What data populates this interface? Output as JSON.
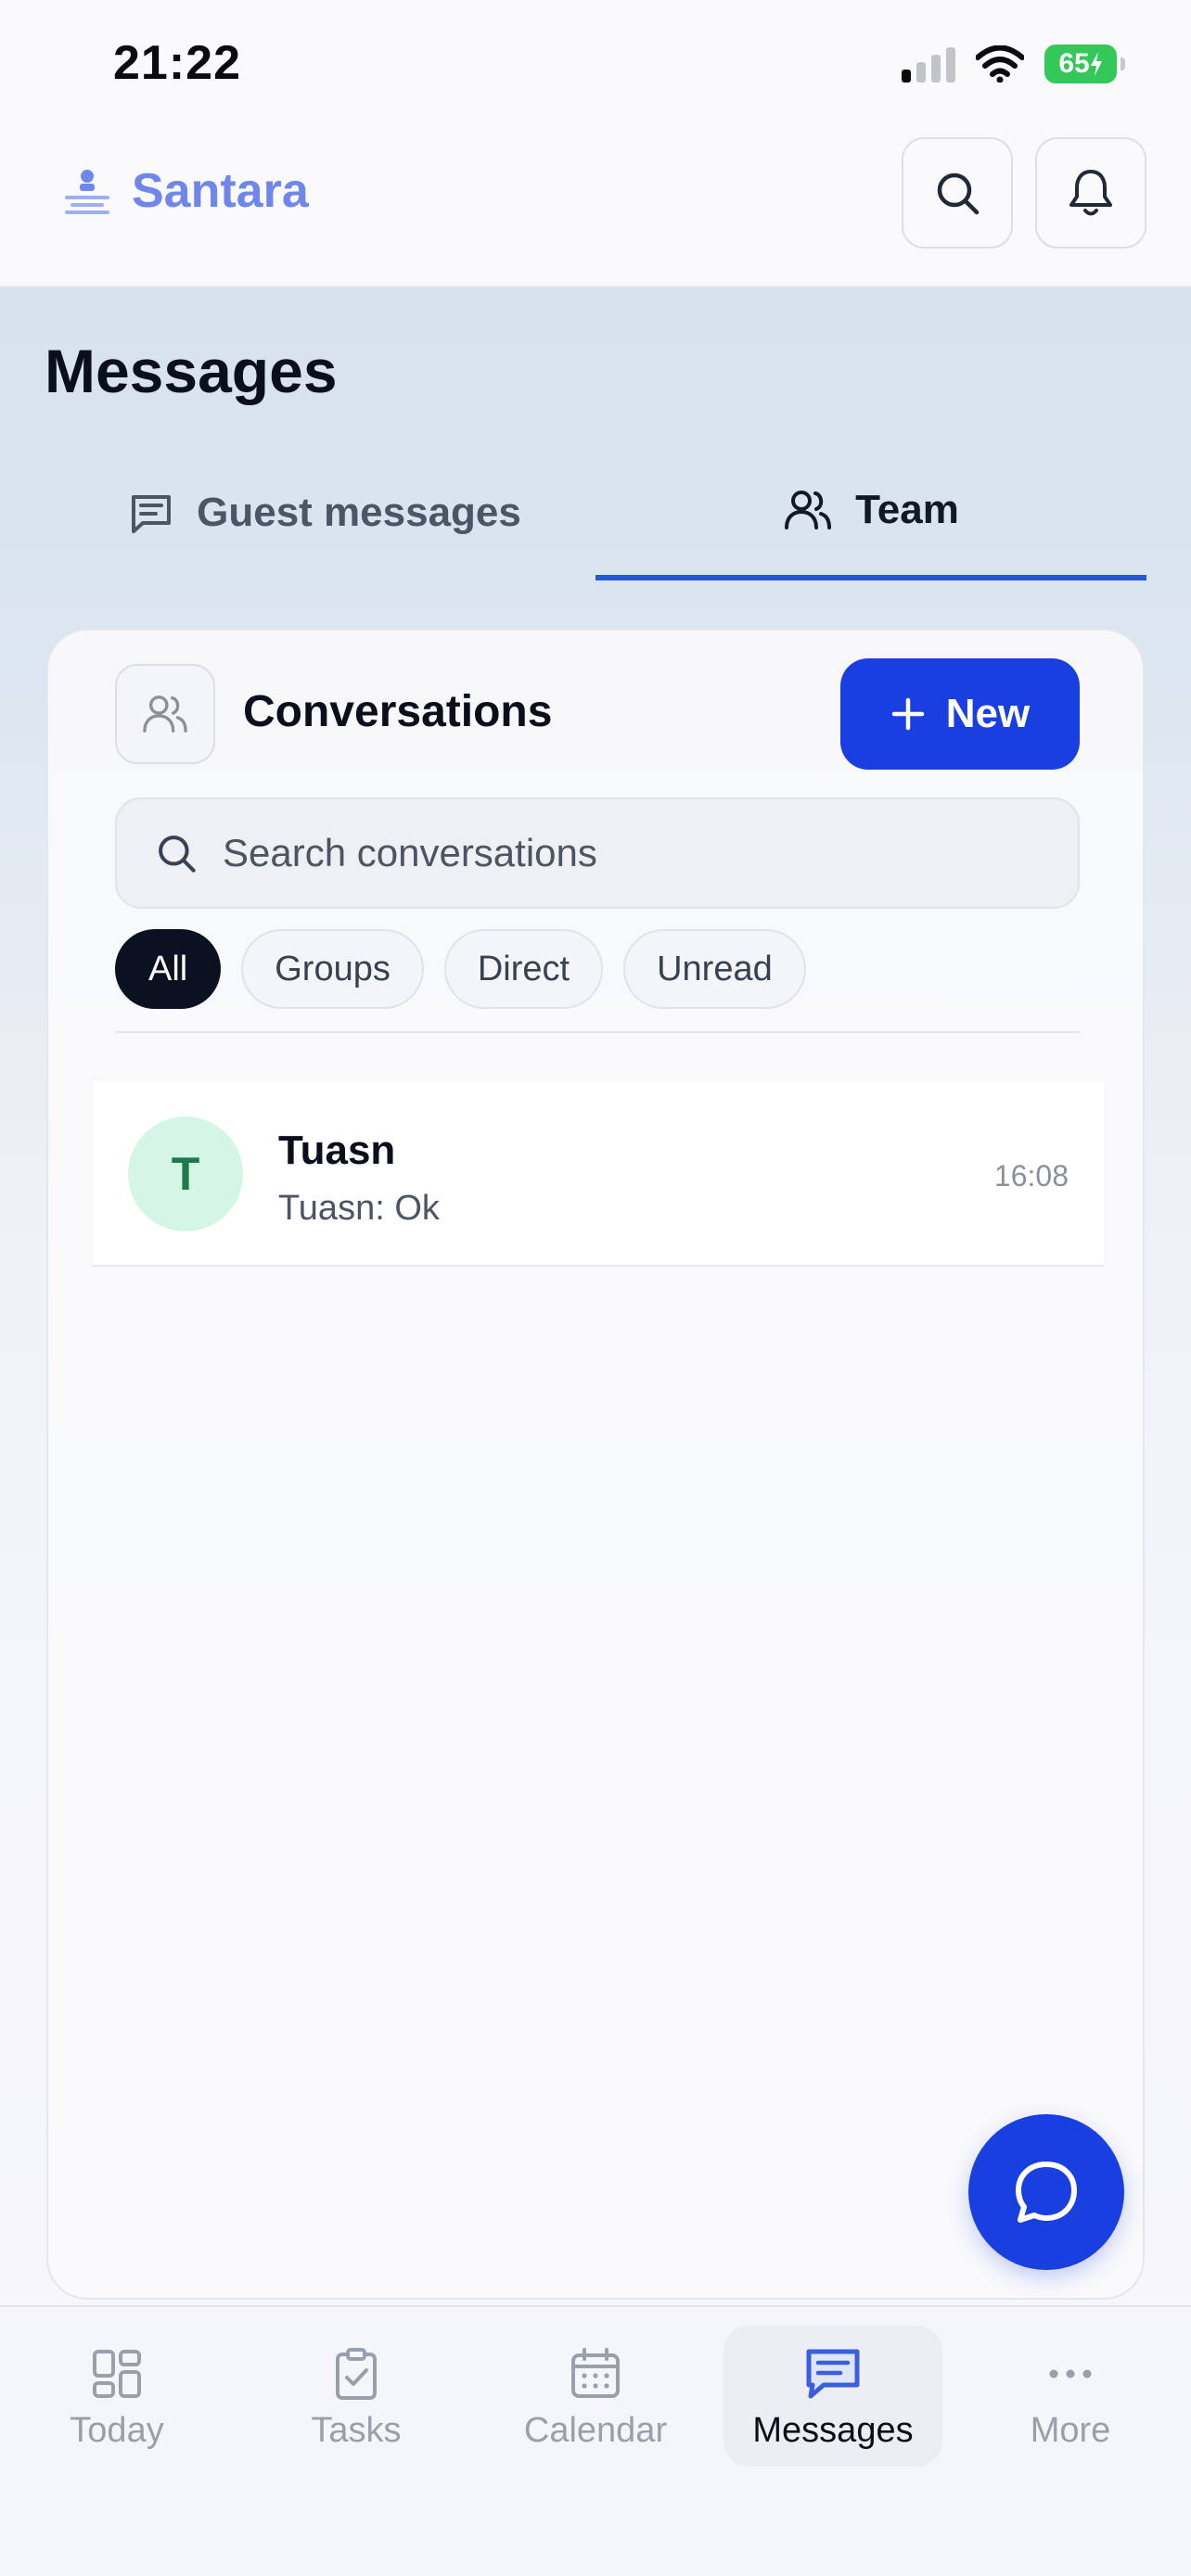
{
  "status_bar": {
    "time": "21:22",
    "battery": "65"
  },
  "header": {
    "brand": "Santara",
    "search_icon": "search-icon",
    "bell_icon": "bell-icon"
  },
  "page": {
    "title": "Messages"
  },
  "tabs": [
    {
      "label": "Guest messages",
      "icon": "message-square-icon",
      "active": false
    },
    {
      "label": "Team",
      "icon": "users-icon",
      "active": true
    }
  ],
  "conversations": {
    "title": "Conversations",
    "new_label": "New",
    "search_placeholder": "Search conversations",
    "filters": [
      "All",
      "Groups",
      "Direct",
      "Unread"
    ],
    "active_filter": "All",
    "items": [
      {
        "avatar": "T",
        "name": "Tuasn",
        "preview": "Tuasn: Ok",
        "time": "16:08"
      }
    ]
  },
  "nav": [
    {
      "label": "Today",
      "icon": "dashboard-icon",
      "active": false
    },
    {
      "label": "Tasks",
      "icon": "clipboard-check-icon",
      "active": false
    },
    {
      "label": "Calendar",
      "icon": "calendar-icon",
      "active": false
    },
    {
      "label": "Messages",
      "icon": "messages-icon",
      "active": true
    },
    {
      "label": "More",
      "icon": "more-horizontal-icon",
      "active": false
    }
  ],
  "colors": {
    "accent": "#1a3fe0",
    "brand": "#6f86ea",
    "tab_underline": "#2657d9"
  }
}
